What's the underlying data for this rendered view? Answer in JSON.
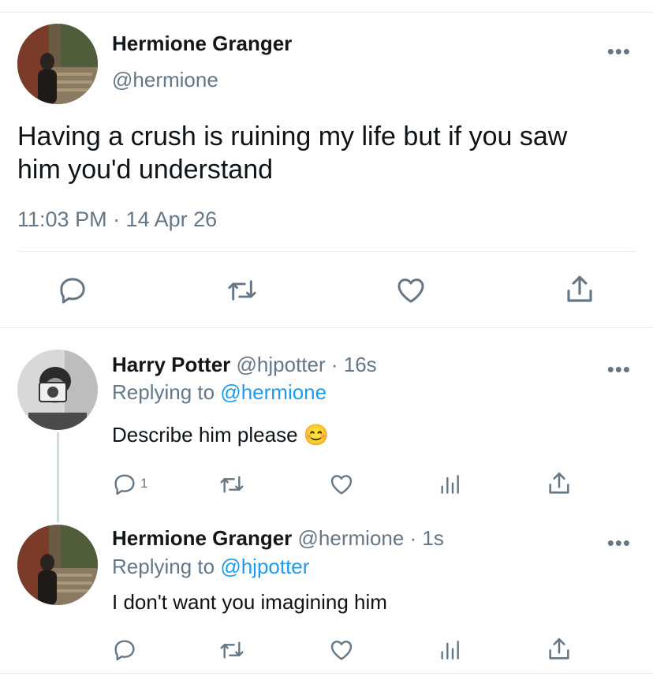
{
  "main_tweet": {
    "name": "Hermione Granger",
    "handle": "@hermione",
    "text_line1": "Having a crush is ruining my life but if you saw",
    "text_line2": "him you'd understand",
    "timestamp": "11:03 PM · 14 Apr 26",
    "more": "•••",
    "actions": [
      "reply-icon",
      "retweet-icon",
      "like-icon",
      "share-icon"
    ]
  },
  "replies": [
    {
      "name": "Harry Potter",
      "meta": "@hjpotter · 16s",
      "replying_prefix": "Replying to",
      "replying_to": "@hermione",
      "text": "Describe him please",
      "emoji": "😊",
      "reply_count": "1",
      "more": "•••"
    },
    {
      "name": "Hermione Granger",
      "meta": "@hermione · 1s",
      "replying_prefix": "Replying to",
      "replying_to": "@hjpotter",
      "text": "I don't want you imagining him",
      "more": "•••"
    }
  ],
  "colors": {
    "link": "#1d9bf0",
    "secondary": "#657786",
    "divider": "#e6e8ea"
  }
}
